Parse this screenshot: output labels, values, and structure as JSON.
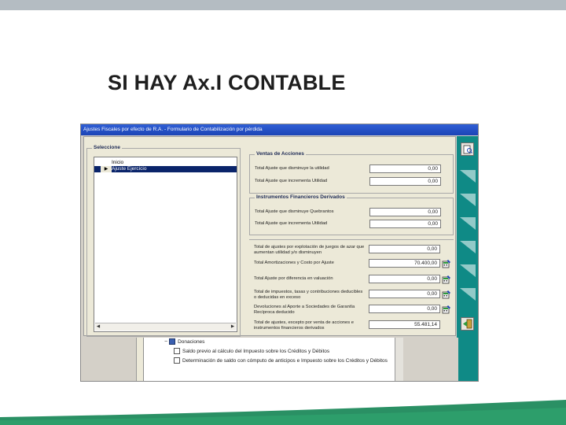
{
  "slide": {
    "title": "SI HAY Ax.I CONTABLE"
  },
  "dialog": {
    "window_title": "Ajustes Fiscales por efecto de R.A. - Formulario de Contabilización por pérdida",
    "selection_group": "Seleccione",
    "list_items": [
      "Inicio",
      "Ajuste Ejercicio"
    ],
    "groups": {
      "sales": "Ventas de Acciones",
      "instruments": "Instrumentos Financieros Derivados"
    },
    "fields": {
      "sales_decrease_label": "Total Ajuste que disminuye la utilidad",
      "sales_decrease_value": "0,00",
      "sales_increase_label": "Total Ajuste que incrementa Utilidad",
      "sales_increase_value": "0,00",
      "deriv_decrease_label": "Total Ajuste que disminuye Quebrantos",
      "deriv_decrease_value": "0,00",
      "deriv_increase_label": "Total Ajuste que incrementa Utilidad",
      "deriv_increase_value": "0,00",
      "games_label": "Total de ajustes por explotación de juegos de azar que aumentan utilidad y/o disminuyen",
      "games_value": "0,00",
      "amort_label": "Total Amortizaciones y Costo por Ajuste",
      "amort_value": "70.400,00",
      "revalue_label": "Total Ajuste por diferencia en valuación",
      "revalue_value": "0,00",
      "taxes_label": "Total de impuestos, tasas y contribuciones deducibles o deducidas en exceso",
      "taxes_value": "0,00",
      "refund_label": "Devoluciones al Aporte a Sociedades de Garantía Recíproca deducido",
      "refund_value": "0,00",
      "except_label": "Total de ajustes, excepto por venta de acciones e instrumentos financieros derivados",
      "except_value": "55.481,14"
    }
  },
  "background_window": {
    "tree": [
      "Donaciones",
      "Saldo previo al cálculo del Impuesto sobre los Créditos y Débitos",
      "Determinación de saldo con cómputo de anticipos e Impuesto sobre los Créditos y Débitos"
    ]
  },
  "colors": {
    "titlebar": "#1c44b5",
    "selection": "#0a246a",
    "side_bar": "#0f8a86",
    "bottom_wave": "#1f8a5c"
  }
}
